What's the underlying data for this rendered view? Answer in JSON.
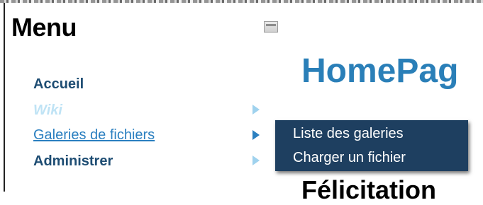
{
  "menu": {
    "title": "Menu",
    "items": [
      {
        "label": "Accueil"
      },
      {
        "label": "Wiki"
      },
      {
        "label": "Galeries de fichiers"
      },
      {
        "label": "Administrer"
      }
    ]
  },
  "content": {
    "title": "HomePag",
    "heading": "Félicitation"
  },
  "submenu": {
    "items": [
      {
        "label": "Liste des galeries"
      },
      {
        "label": "Charger un fichier"
      }
    ]
  },
  "colors": {
    "nav_text": "#1e4d73",
    "link": "#2a7fc0",
    "faded": "#bfe3f5",
    "submenu_bg": "#1e3f60",
    "page_title": "#2a7fb8"
  },
  "icons": [
    "toggle-icon",
    "arrow-right-icon"
  ]
}
